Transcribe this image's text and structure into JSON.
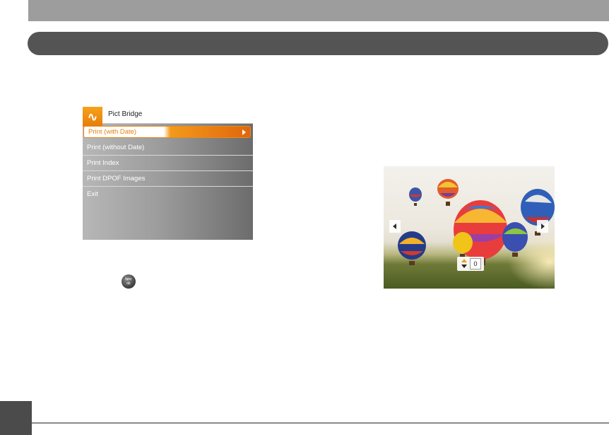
{
  "menu": {
    "title": "Pict Bridge",
    "items": [
      {
        "label": "Print (with Date)",
        "selected": true
      },
      {
        "label": "Print (without Date)"
      },
      {
        "label": "Print Index"
      },
      {
        "label": "Print DPOF Images"
      },
      {
        "label": "Exit"
      }
    ]
  },
  "func_ok_button": {
    "line1": "func",
    "line2": "ok"
  },
  "photo": {
    "copies": "0"
  },
  "colors": {
    "accent": "#f39a1b",
    "header_bar": "#545454",
    "top_strip": "#9d9d9d"
  },
  "icons": [
    "pictbridge-logo-icon",
    "func-ok-icon",
    "arrow-left-icon",
    "arrow-right-icon",
    "arrow-up-icon",
    "arrow-down-icon"
  ]
}
